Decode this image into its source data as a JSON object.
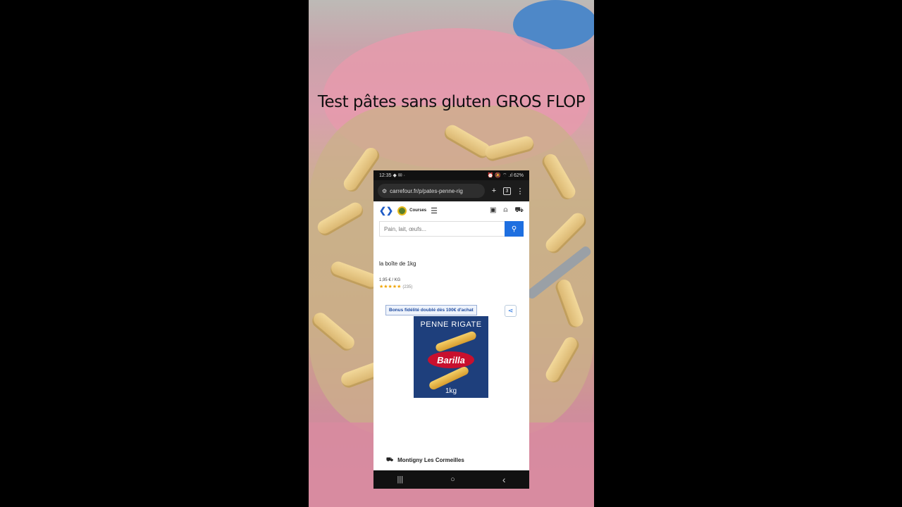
{
  "video": {
    "caption": "Test pâtes sans gluten GROS FLOP"
  },
  "phone": {
    "status_bar": {
      "time": "12:35",
      "left_indicators": "◆ ✉ ·",
      "right_indicators": "⏰ 🔕 ⌔ .ıl",
      "battery": "62%"
    },
    "browser": {
      "url": "carrefour.fr/p/pates-penne-rig",
      "tab_count": "3"
    },
    "site": {
      "logo_icon": "carrefour-logo",
      "courses_label": "Courses",
      "search_placeholder": "Pain, lait, œufs..."
    },
    "product": {
      "subtitle": "la boîte de 1kg",
      "price_per_kg": "1,95 € / KG",
      "rating_stars": "★★★★★",
      "rating_count": "(235)",
      "promo_badge": "Bonus fidélité doublé dès 100€ d'achat",
      "package": {
        "title": "PENNE RIGATE",
        "brand": "Barilla",
        "weight": "1kg"
      }
    },
    "delivery": {
      "store": "Montigny Les Cormeilles"
    },
    "nav": {
      "recents": "|||",
      "home": "○",
      "back": "‹"
    }
  },
  "colors": {
    "carrefour_blue": "#1e6fe0",
    "barilla_red": "#c8102e",
    "box_blue": "#1e3f7c"
  }
}
